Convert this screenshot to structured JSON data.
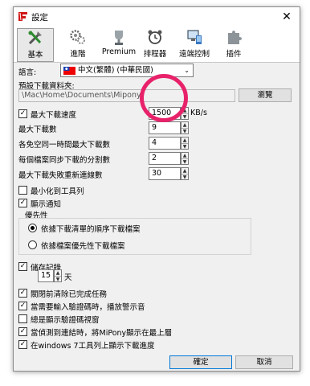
{
  "window": {
    "title": "設定",
    "close_glyph": "✕"
  },
  "toolbar": {
    "tabs": [
      {
        "label": "基本",
        "icon": "tools-icon"
      },
      {
        "label": "進階",
        "icon": "gears-icon"
      },
      {
        "label": "Premium",
        "icon": "premium-trophy-icon"
      },
      {
        "label": "排程器",
        "icon": "scheduler-alarm-icon"
      },
      {
        "label": "遠端控制",
        "icon": "remote-computer-icon"
      },
      {
        "label": "插件",
        "icon": "puzzle-plugin-icon"
      }
    ]
  },
  "language": {
    "label": "語言:",
    "value": "中文(繁體) (中華民國)"
  },
  "download_folder": {
    "label": "預設下載資料夾:",
    "value": "\\Mac\\Home\\Documents\\Mipony",
    "browse": "瀏覽"
  },
  "max_speed": {
    "label": "最大下載速度",
    "value": "1500",
    "unit": "KB/s",
    "checked": true
  },
  "max_downloads": {
    "label": "最大下載數",
    "value": "9"
  },
  "free_space_downloads": {
    "label": "各免空同一時間最大下載數",
    "value": "4"
  },
  "segments": {
    "label": "每個檔案同步下載的分割數",
    "value": "2"
  },
  "retries": {
    "label": "最大下載失敗重新連線數",
    "value": "30"
  },
  "minimize_tray": {
    "label": "最小化到工具列",
    "checked": false
  },
  "notifications": {
    "label": "顯示通知",
    "checked": true
  },
  "priority": {
    "title": "優先性",
    "options": [
      {
        "label": "依據下載清單的順序下載檔案",
        "selected": true
      },
      {
        "label": "依據檔案優先性下載檔案",
        "selected": false
      }
    ]
  },
  "save_log": {
    "label": "儲存記錄",
    "checked": true,
    "days_value": "15",
    "days_unit": "天"
  },
  "clear_completed": {
    "label": "關閉前清除已完成任務",
    "checked": true
  },
  "captcha_sound": {
    "label": "當需要輸入驗證碼時，播放警示音",
    "checked": true
  },
  "captcha_show": {
    "label": "總是顯示驗證碼視窗",
    "checked": false
  },
  "link_detect": {
    "label": "當偵測到連結時，將MiPony顯示在最上層",
    "checked": true
  },
  "win7_taskbar": {
    "label": "在windows 7工具列上顯示下載進度",
    "checked": true
  },
  "buttons": {
    "ok": "確定",
    "cancel": "取消"
  },
  "colors": {
    "highlight_ring": "#e8226a",
    "default_button_border": "#0078d7"
  }
}
